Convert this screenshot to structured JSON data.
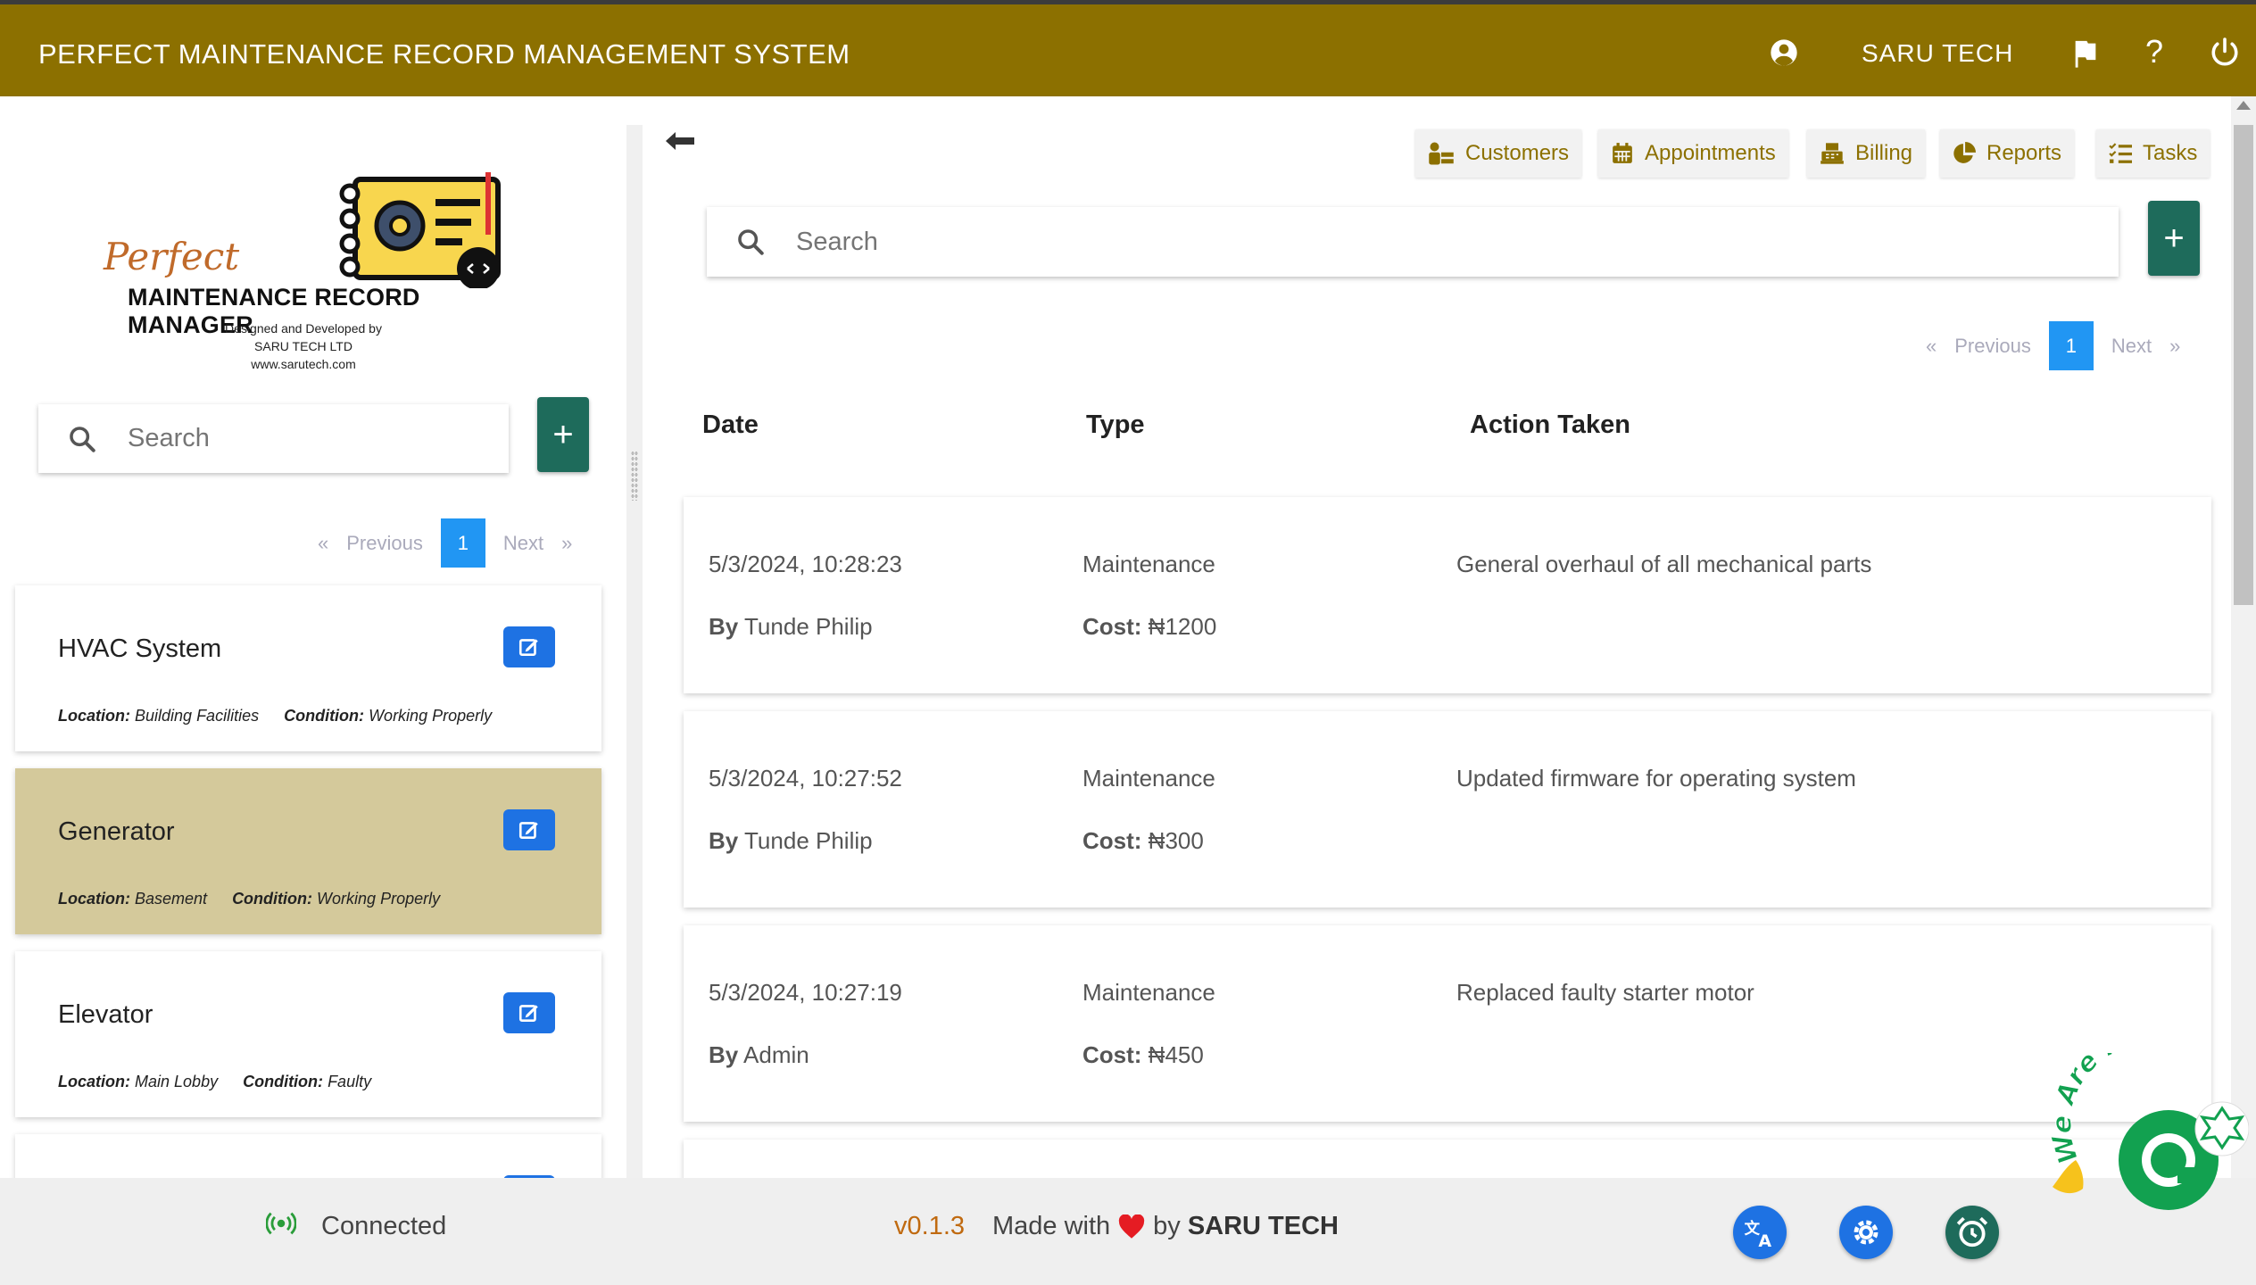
{
  "header": {
    "title": "PERFECT MAINTENANCE RECORD MANAGEMENT SYSTEM",
    "user_name": "SARU TECH",
    "help_label": "?"
  },
  "logo": {
    "script_word": "Perfect",
    "main_text": "MAINTENANCE RECORD MANAGER",
    "line1": "Designed and Developed by",
    "line2": "SARU TECH LTD",
    "line3": "www.sarutech.com"
  },
  "left": {
    "search_placeholder": "Search",
    "add_label": "+",
    "pager": {
      "first": "«",
      "previous": "Previous",
      "current": "1",
      "next": "Next",
      "last": "»"
    },
    "location_label": "Location:",
    "condition_label": "Condition:",
    "assets": [
      {
        "name": "HVAC System",
        "location": "Building Facilities",
        "condition": "Working Properly"
      },
      {
        "name": "Generator",
        "location": "Basement",
        "condition": "Working Properly"
      },
      {
        "name": "Elevator",
        "location": "Main Lobby",
        "condition": "Faulty"
      }
    ]
  },
  "right": {
    "nav": [
      {
        "label": "Customers",
        "icon": "customers-icon"
      },
      {
        "label": "Appointments",
        "icon": "calendar-icon"
      },
      {
        "label": "Billing",
        "icon": "register-icon"
      },
      {
        "label": "Reports",
        "icon": "pie-chart-icon"
      },
      {
        "label": "Tasks",
        "icon": "task-list-icon"
      }
    ],
    "search_placeholder": "Search",
    "add_label": "+",
    "pager": {
      "first": "«",
      "previous": "Previous",
      "current": "1",
      "next": "Next",
      "last": "»"
    },
    "columns": [
      "Date",
      "Type",
      "Action Taken"
    ],
    "by_label": "By",
    "cost_label": "Cost:",
    "records": [
      {
        "date": "5/3/2024, 10:28:23",
        "type": "Maintenance",
        "action": "General overhaul of all mechanical parts",
        "by": "Tunde Philip",
        "cost": "₦1200"
      },
      {
        "date": "5/3/2024, 10:27:52",
        "type": "Maintenance",
        "action": "Updated firmware for operating system",
        "by": "Tunde Philip",
        "cost": "₦300"
      },
      {
        "date": "5/3/2024, 10:27:19",
        "type": "Maintenance",
        "action": "Replaced faulty starter motor",
        "by": "Admin",
        "cost": "₦450"
      }
    ]
  },
  "chat_badge": {
    "text": "We Are Here"
  },
  "footer": {
    "connection": "Connected",
    "version": "v0.1.3",
    "made_with": "Made with",
    "by": "by",
    "brand": "SARU TECH"
  },
  "colors": {
    "header_bg": "#8c7000",
    "accent_green": "#1e6b5b",
    "pager_blue": "#2196f3",
    "edit_blue": "#1e72e3",
    "selected_card": "#d4c99b",
    "chat_green": "#12a150"
  }
}
